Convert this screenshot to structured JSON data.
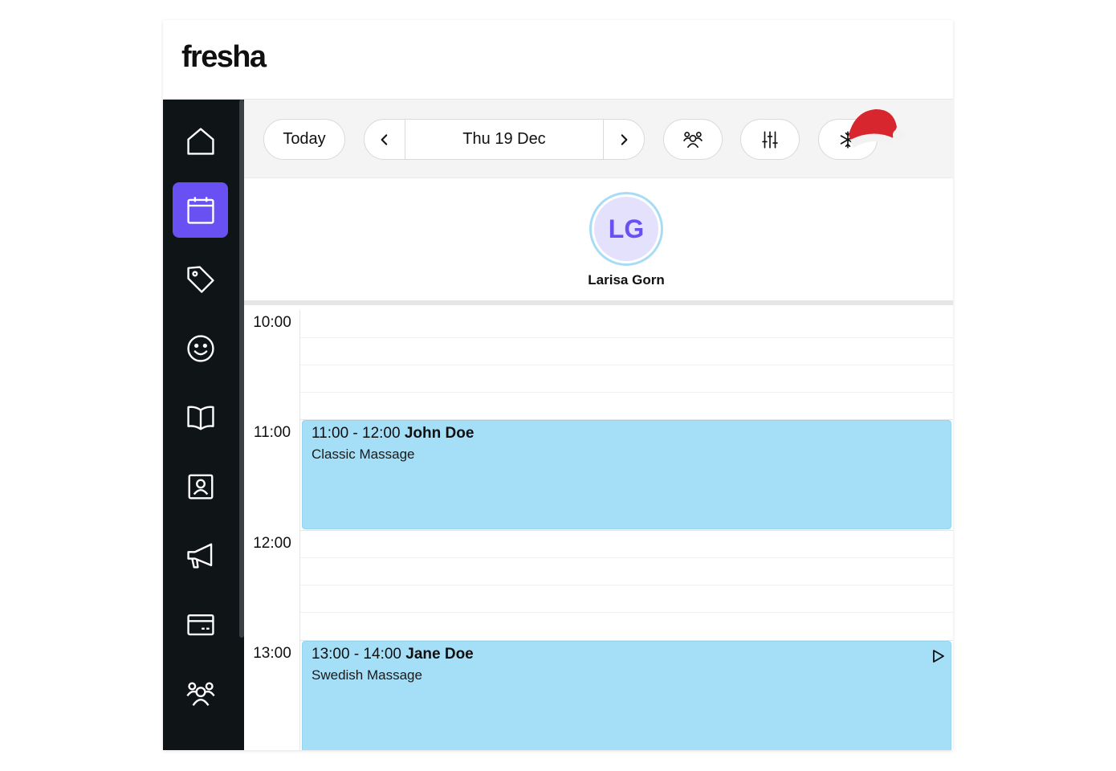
{
  "header": {
    "logo": "fresha"
  },
  "sidebar": {
    "items": [
      {
        "name": "home",
        "icon": "home-icon",
        "active": false
      },
      {
        "name": "calendar",
        "icon": "calendar-icon",
        "active": true
      },
      {
        "name": "sales",
        "icon": "tag-icon",
        "active": false
      },
      {
        "name": "clients",
        "icon": "smiley-icon",
        "active": false
      },
      {
        "name": "catalog",
        "icon": "book-icon",
        "active": false
      },
      {
        "name": "team",
        "icon": "contact-card-icon",
        "active": false
      },
      {
        "name": "marketing",
        "icon": "megaphone-icon",
        "active": false
      },
      {
        "name": "payments",
        "icon": "card-icon",
        "active": false
      },
      {
        "name": "people",
        "icon": "group-icon",
        "active": false
      }
    ]
  },
  "toolbar": {
    "today_label": "Today",
    "date_label": "Thu 19 Dec",
    "prev_icon": "chevron-left-icon",
    "next_icon": "chevron-right-icon",
    "team_icon": "team-icon",
    "settings_icon": "sliders-icon",
    "theme_icon": "snowflake-icon"
  },
  "staff": {
    "initials": "LG",
    "name": "Larisa Gorn"
  },
  "calendar": {
    "time_slots": [
      "10:00",
      "11:00",
      "12:00",
      "13:00"
    ],
    "appointments": [
      {
        "time": "11:00 - 12:00",
        "client": "John Doe",
        "service": "Classic Massage"
      },
      {
        "time": "13:00 - 14:00",
        "client": "Jane Doe",
        "service": "Swedish Massage"
      }
    ]
  },
  "colors": {
    "accent": "#6950f3",
    "sidebar_bg": "#0f1417",
    "appointment_bg": "#a5def7",
    "toolbar_bg": "#f4f4f5"
  }
}
